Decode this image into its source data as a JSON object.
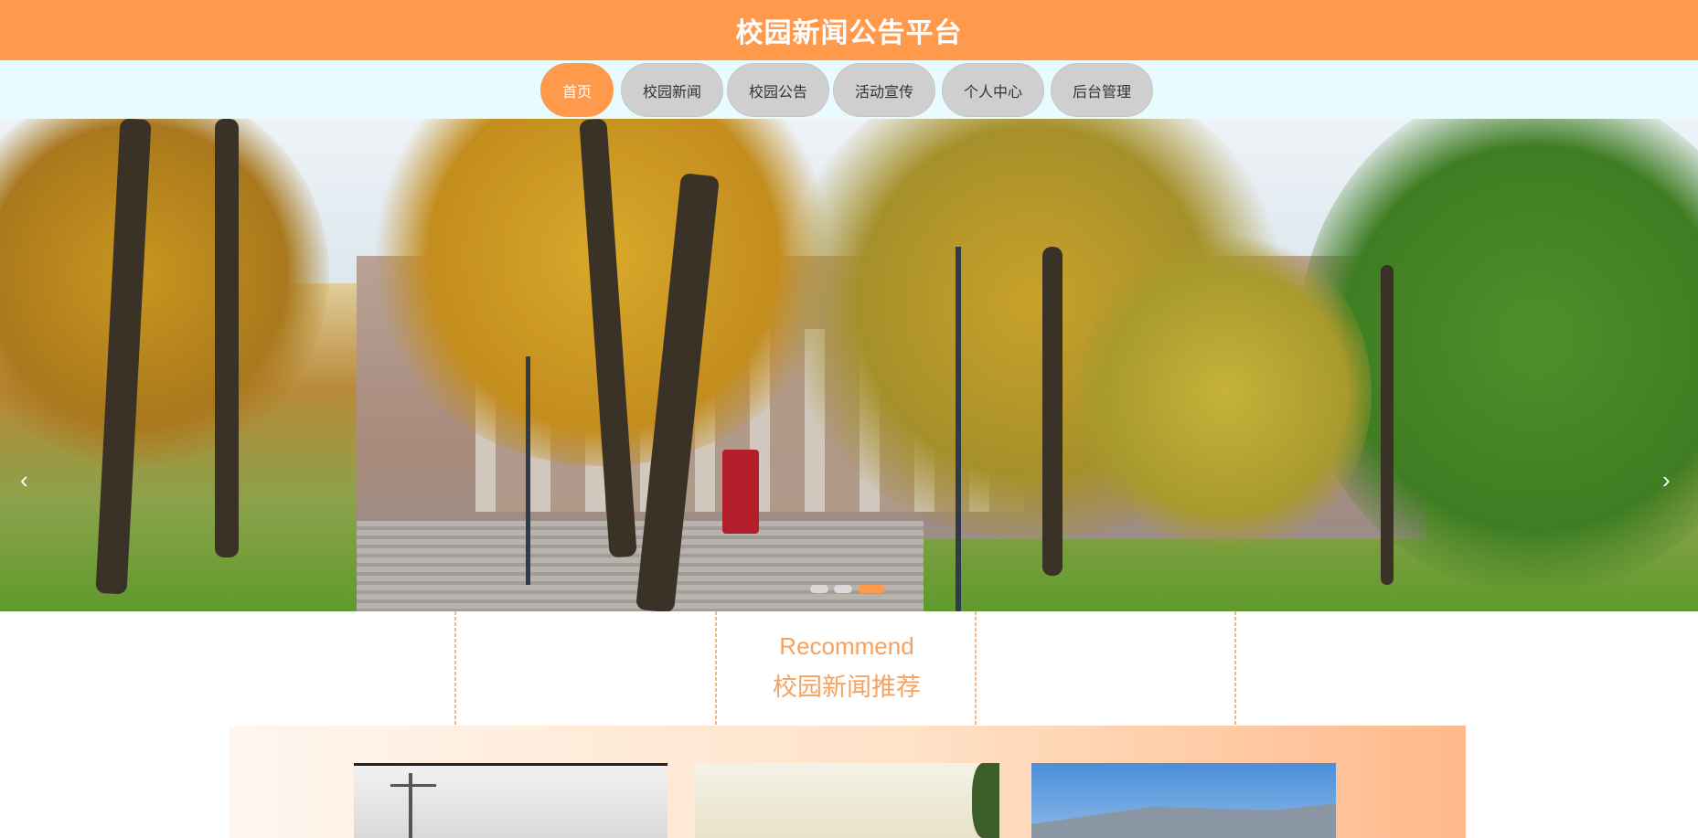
{
  "header": {
    "title": "校园新闻公告平台"
  },
  "nav": {
    "items": [
      {
        "label": "首页",
        "active": true
      },
      {
        "label": "校园新闻",
        "active": false
      },
      {
        "label": "校园公告",
        "active": false
      },
      {
        "label": "活动宣传",
        "active": false
      },
      {
        "label": "个人中心",
        "active": false
      },
      {
        "label": "后台管理",
        "active": false
      }
    ]
  },
  "carousel": {
    "prev_icon": "chevron-left-icon",
    "next_icon": "chevron-right-icon",
    "prev_glyph": "‹",
    "next_glyph": "›",
    "slide_count": 3,
    "active_slide": 3
  },
  "recommend": {
    "title_en": "Recommend",
    "title_cn": "校园新闻推荐"
  },
  "colors": {
    "accent": "#ff9a4d",
    "nav_bg": "#e8fbff",
    "nav_inactive": "#cfcfcf",
    "recommend_text": "#f4a261"
  }
}
